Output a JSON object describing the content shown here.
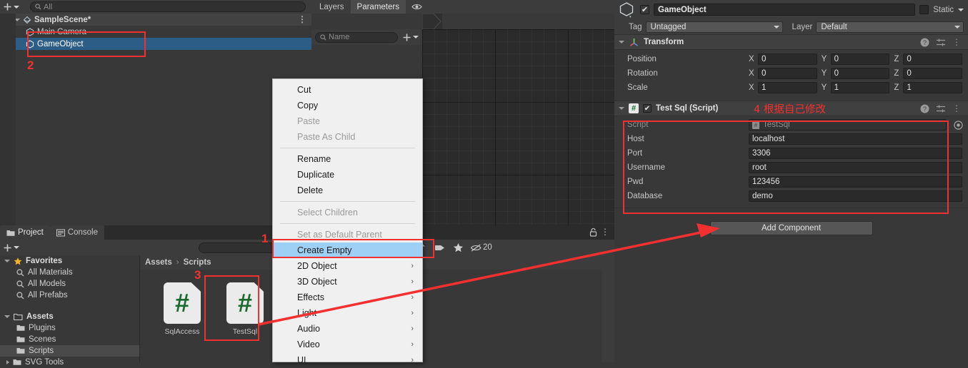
{
  "hierarchy": {
    "toolbar": {
      "create_label": "+",
      "search_placeholder": "All",
      "search_value": "All"
    },
    "rows": [
      {
        "label": "SampleScene*",
        "icon": "scene-icon",
        "depth": 0,
        "state": "scene",
        "expanded": true
      },
      {
        "label": "Main Camera",
        "icon": "gameobject-icon",
        "depth": 1,
        "state": "normal"
      },
      {
        "label": "GameObject",
        "icon": "gameobject-icon",
        "depth": 1,
        "state": "selected"
      }
    ]
  },
  "animator": {
    "tabs": [
      {
        "label": "Layers",
        "active": false
      },
      {
        "label": "Parameters",
        "active": true
      }
    ],
    "eye_icon": "eye-icon",
    "search_placeholder": "Name",
    "search_value": "Name",
    "add_label": "+"
  },
  "project": {
    "tabs": [
      {
        "label": "Project",
        "icon": "folder-icon",
        "active": true
      },
      {
        "label": "Console",
        "icon": "console-icon",
        "active": false
      }
    ],
    "toolbar": {
      "create_label": "+",
      "search_value": "",
      "search_placeholder": "",
      "lock_icon": "lock-icon",
      "kebab_icon": "kebab-icon",
      "filters": [
        {
          "icon": "asset-type-filter-icon",
          "label": ""
        },
        {
          "icon": "label-filter-icon",
          "label": ""
        },
        {
          "icon": "favorite-filter-icon",
          "label": ""
        }
      ],
      "hidden_count_icon": "hidden-eye-icon",
      "hidden_count": "20"
    },
    "tree": [
      {
        "label": "Favorites",
        "icon": "star-icon",
        "depth": 0,
        "type": "header"
      },
      {
        "label": "All Materials",
        "icon": "search-icon",
        "depth": 1,
        "type": "item"
      },
      {
        "label": "All Models",
        "icon": "search-icon",
        "depth": 1,
        "type": "item"
      },
      {
        "label": "All Prefabs",
        "icon": "search-icon",
        "depth": 1,
        "type": "item"
      },
      {
        "label": "",
        "icon": "",
        "depth": 0,
        "type": "spacer"
      },
      {
        "label": "Assets",
        "icon": "folder-open-icon",
        "depth": 0,
        "type": "header",
        "expanded": true
      },
      {
        "label": "Plugins",
        "icon": "folder-icon",
        "depth": 1,
        "type": "item"
      },
      {
        "label": "Scenes",
        "icon": "folder-icon",
        "depth": 1,
        "type": "item"
      },
      {
        "label": "Scripts",
        "icon": "folder-icon",
        "depth": 1,
        "type": "item",
        "selected": true
      },
      {
        "label": "SVG Tools",
        "icon": "folder-icon",
        "depth": 1,
        "type": "item",
        "expandable": true
      }
    ],
    "breadcrumb": [
      "Assets",
      "Scripts"
    ],
    "assets": [
      {
        "label": "SqlAccess",
        "icon": "csharp-script-icon"
      },
      {
        "label": "TestSql",
        "icon": "csharp-script-icon"
      }
    ]
  },
  "inspector": {
    "object_icon": "gameobject-icon",
    "enabled": true,
    "name": "GameObject",
    "static_label": "Static",
    "static_checked": false,
    "tag_label": "Tag",
    "tag_value": "Untagged",
    "layer_label": "Layer",
    "layer_value": "Default",
    "transform": {
      "title": "Transform",
      "icon": "transform-icon",
      "rows": [
        {
          "label": "Position",
          "x": "0",
          "y": "0",
          "z": "0"
        },
        {
          "label": "Rotation",
          "x": "0",
          "y": "0",
          "z": "0"
        },
        {
          "label": "Scale",
          "x": "1",
          "y": "1",
          "z": "1"
        }
      ],
      "axes": [
        "X",
        "Y",
        "Z"
      ],
      "actions": [
        "help-icon",
        "preset-icon",
        "kebab-icon"
      ]
    },
    "script_component": {
      "title": "Test Sql (Script)",
      "icon": "csharp-script-icon",
      "enabled": true,
      "actions": [
        "help-icon",
        "preset-icon",
        "kebab-icon"
      ],
      "fields": [
        {
          "label": "Script",
          "value": "TestSql",
          "readonly": true,
          "picker": "object-picker-icon"
        },
        {
          "label": "Host",
          "value": "localhost",
          "readonly": false
        },
        {
          "label": "Port",
          "value": "3306",
          "readonly": false
        },
        {
          "label": "Username",
          "value": "root",
          "readonly": false
        },
        {
          "label": "Pwd",
          "value": "123456",
          "readonly": false
        },
        {
          "label": "Database",
          "value": "demo",
          "readonly": false
        }
      ]
    },
    "add_component_label": "Add Component"
  },
  "context_menu": {
    "items": [
      {
        "label": "Cut",
        "state": "normal"
      },
      {
        "label": "Copy",
        "state": "normal"
      },
      {
        "label": "Paste",
        "state": "disabled"
      },
      {
        "label": "Paste As Child",
        "state": "disabled"
      },
      {
        "label": "__sep__",
        "state": "separator"
      },
      {
        "label": "Rename",
        "state": "normal"
      },
      {
        "label": "Duplicate",
        "state": "normal"
      },
      {
        "label": "Delete",
        "state": "normal"
      },
      {
        "label": "__sep__",
        "state": "separator"
      },
      {
        "label": "Select Children",
        "state": "disabled"
      },
      {
        "label": "__sep__",
        "state": "separator"
      },
      {
        "label": "Set as Default Parent",
        "state": "disabled"
      },
      {
        "label": "Create Empty",
        "state": "selected"
      },
      {
        "label": "2D Object",
        "state": "submenu"
      },
      {
        "label": "3D Object",
        "state": "submenu"
      },
      {
        "label": "Effects",
        "state": "submenu"
      },
      {
        "label": "Light",
        "state": "submenu"
      },
      {
        "label": "Audio",
        "state": "submenu"
      },
      {
        "label": "Video",
        "state": "submenu"
      },
      {
        "label": "UI",
        "state": "submenu"
      }
    ],
    "submenu_arrow": "chevron-right-icon"
  },
  "annotations": {
    "color": "#f23030",
    "markers": [
      {
        "id": "1",
        "text": "1"
      },
      {
        "id": "2",
        "text": "2"
      },
      {
        "id": "3",
        "text": "3"
      },
      {
        "id": "4",
        "text": "4 根据自己修改"
      }
    ],
    "marker1": "1",
    "marker2": "2",
    "marker3": "3",
    "marker4": "4 根据自己修改"
  }
}
